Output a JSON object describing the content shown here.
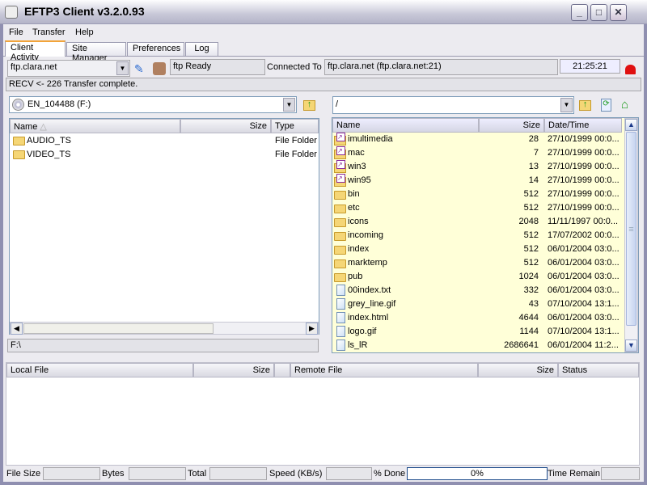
{
  "window": {
    "title": "EFTP3 Client v3.2.0.93",
    "minimize": "_",
    "maximize": "□",
    "close": "✕"
  },
  "menu": [
    "File",
    "Transfer",
    "Help"
  ],
  "tabs": [
    "Client Activity",
    "Site Manager",
    "Preferences",
    "Log"
  ],
  "toolbar": {
    "site": "ftp.clara.net",
    "status": "ftp Ready",
    "connected_label": "Connected To",
    "connected_value": "ftp.clara.net (ftp.clara.net:21)",
    "time": "21:25:21"
  },
  "log_line": "RECV <-  226 Transfer complete.",
  "local": {
    "drive": "EN_104488 (F:)",
    "columns": [
      "Name",
      "Size",
      "Type"
    ],
    "sort_indicator": "△",
    "rows": [
      {
        "name": "AUDIO_TS",
        "size": "",
        "type": "File Folder"
      },
      {
        "name": "VIDEO_TS",
        "size": "",
        "type": "File Folder"
      }
    ],
    "path": "F:\\"
  },
  "remote": {
    "path": "/",
    "columns": [
      "Name",
      "Size",
      "Date/Time"
    ],
    "rows": [
      {
        "icon": "link",
        "name": "imultimedia",
        "size": "28",
        "date": "27/10/1999 00:0..."
      },
      {
        "icon": "link",
        "name": "mac",
        "size": "7",
        "date": "27/10/1999 00:0..."
      },
      {
        "icon": "link",
        "name": "win3",
        "size": "13",
        "date": "27/10/1999 00:0..."
      },
      {
        "icon": "link",
        "name": "win95",
        "size": "14",
        "date": "27/10/1999 00:0..."
      },
      {
        "icon": "folder",
        "name": "bin",
        "size": "512",
        "date": "27/10/1999 00:0..."
      },
      {
        "icon": "folder",
        "name": "etc",
        "size": "512",
        "date": "27/10/1999 00:0..."
      },
      {
        "icon": "folder",
        "name": "icons",
        "size": "2048",
        "date": "11/11/1997 00:0..."
      },
      {
        "icon": "folder",
        "name": "incoming",
        "size": "512",
        "date": "17/07/2002 00:0..."
      },
      {
        "icon": "folder",
        "name": "index",
        "size": "512",
        "date": "06/01/2004 03:0..."
      },
      {
        "icon": "folder",
        "name": "marktemp",
        "size": "512",
        "date": "06/01/2004 03:0..."
      },
      {
        "icon": "folder",
        "name": "pub",
        "size": "1024",
        "date": "06/01/2004 03:0..."
      },
      {
        "icon": "file",
        "name": "00index.txt",
        "size": "332",
        "date": "06/01/2004 03:0..."
      },
      {
        "icon": "file",
        "name": "grey_line.gif",
        "size": "43",
        "date": "07/10/2004 13:1..."
      },
      {
        "icon": "file",
        "name": "index.html",
        "size": "4644",
        "date": "06/01/2004 03:0..."
      },
      {
        "icon": "file",
        "name": "logo.gif",
        "size": "1144",
        "date": "07/10/2004 13:1..."
      },
      {
        "icon": "file",
        "name": "ls_lR",
        "size": "2686641",
        "date": "06/01/2004 11:2..."
      }
    ],
    "list_bg": "#ffffd8"
  },
  "queue": {
    "columns": [
      "Local File",
      "Size",
      "",
      "Remote File",
      "Size",
      "Status"
    ]
  },
  "statusbar": {
    "file_size": "File Size",
    "bytes": "Bytes",
    "total": "Total",
    "speed": "Speed (KB/s)",
    "done": "% Done",
    "progress": "0%",
    "progress_value": 0,
    "time_remain": "Time Remain"
  }
}
